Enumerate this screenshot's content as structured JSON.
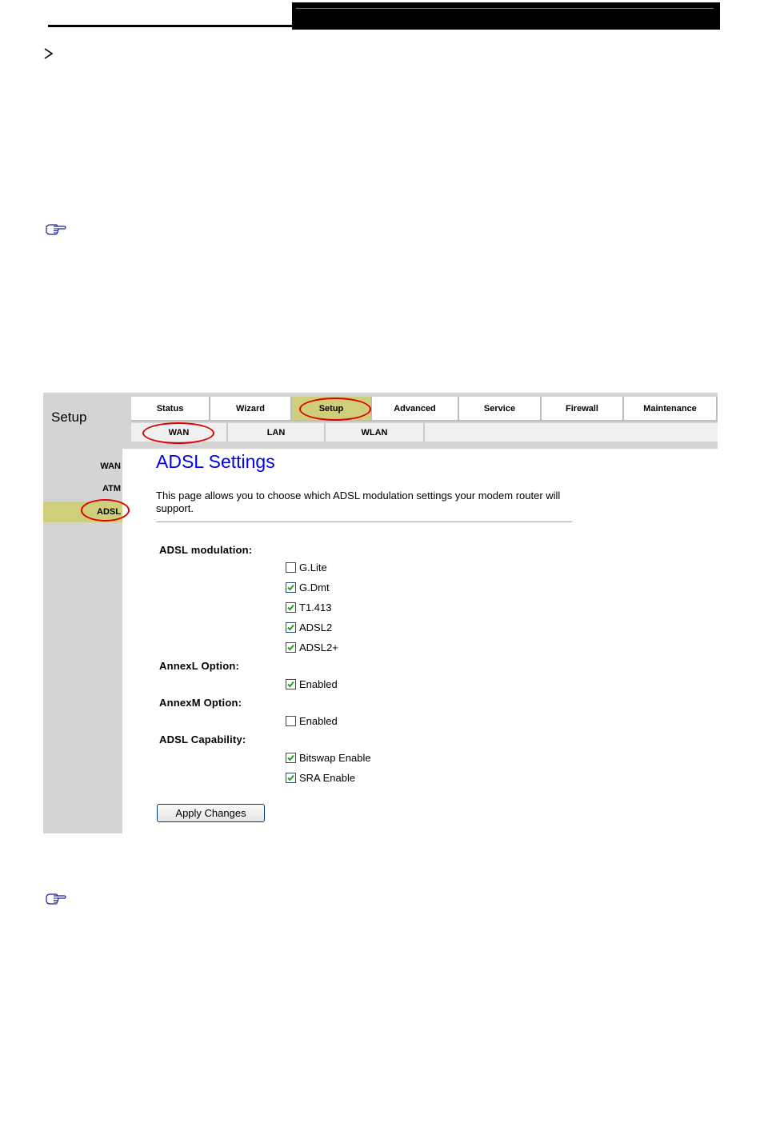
{
  "ui": {
    "title": "Setup",
    "tabs": [
      {
        "label": "Status",
        "active": false
      },
      {
        "label": "Wizard",
        "active": false
      },
      {
        "label": "Setup",
        "active": true
      },
      {
        "label": "Advanced",
        "active": false
      },
      {
        "label": "Service",
        "active": false
      },
      {
        "label": "Firewall",
        "active": false
      },
      {
        "label": "Maintenance",
        "active": false
      }
    ],
    "subtabs": [
      {
        "label": "WAN",
        "active": true
      },
      {
        "label": "LAN",
        "active": false
      },
      {
        "label": "WLAN",
        "active": false
      }
    ],
    "sidebar": [
      {
        "label": "WAN",
        "active": false
      },
      {
        "label": "ATM",
        "active": false
      },
      {
        "label": "ADSL",
        "active": true
      }
    ],
    "page_title": "ADSL Settings",
    "description": "This page allows you to choose which ADSL modulation settings your modem router will support.",
    "sections": {
      "modulation": {
        "label": "ADSL modulation:",
        "options": [
          {
            "label": "G.Lite",
            "checked": false
          },
          {
            "label": "G.Dmt",
            "checked": true
          },
          {
            "label": "T1.413",
            "checked": true
          },
          {
            "label": "ADSL2",
            "checked": true
          },
          {
            "label": "ADSL2+",
            "checked": true
          }
        ]
      },
      "annexl": {
        "label": "AnnexL Option:",
        "options": [
          {
            "label": "Enabled",
            "checked": true
          }
        ]
      },
      "annexm": {
        "label": "AnnexM Option:",
        "options": [
          {
            "label": "Enabled",
            "checked": false
          }
        ]
      },
      "capability": {
        "label": "ADSL Capability:",
        "options": [
          {
            "label": "Bitswap Enable",
            "checked": true
          },
          {
            "label": "SRA Enable",
            "checked": true
          }
        ]
      }
    },
    "apply_label": "Apply Changes"
  },
  "colors": {
    "active_tab": "#cfcf7a",
    "chrome_gray": "#d4d4d4",
    "title_blue": "#0000ee",
    "annotation_red": "#e00000",
    "checkmark_green": "#21a121"
  },
  "icons": {
    "bullet": "arrowhead-bullet-icon",
    "note": "pointing-hand-icon"
  }
}
